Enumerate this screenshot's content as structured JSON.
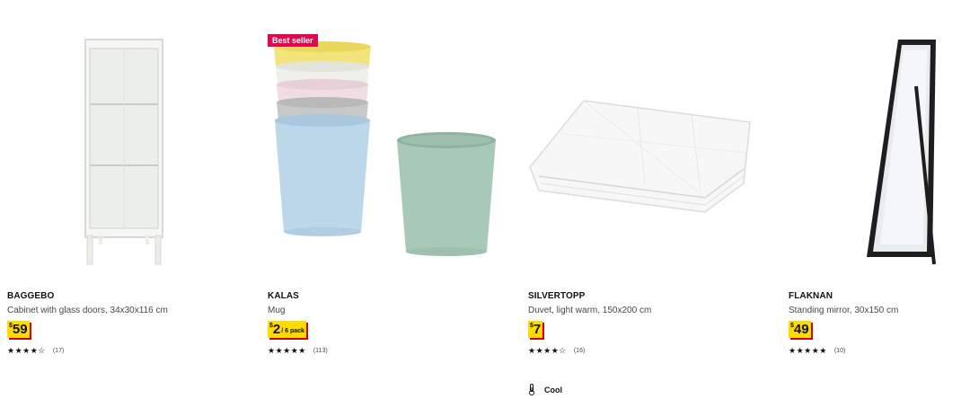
{
  "products": [
    {
      "name": "BAGGEBO",
      "description": "Cabinet with glass doors, 34x30x116 cm",
      "price_currency": "$",
      "price_amount": "59",
      "price_unit": "",
      "stars": "★★★★☆",
      "rating": 4.5,
      "review_count": "(17)",
      "image_icon": "glass-cabinet"
    },
    {
      "name": "KALAS",
      "description": "Mug",
      "badge": "Best seller",
      "price_currency": "$",
      "price_amount": "2",
      "price_unit": "/ 6 pack",
      "stars": "★★★★★",
      "rating": 5,
      "review_count": "(113)",
      "image_icon": "mugs"
    },
    {
      "name": "SILVERTOPP",
      "description": "Duvet, light warm, 150x200 cm",
      "price_currency": "$",
      "price_amount": "7",
      "price_unit": "",
      "stars": "★★★★☆",
      "rating": 4.5,
      "review_count": "(16)",
      "image_icon": "duvet",
      "extra_label": "Cool",
      "extra_icon": "thermometer-icon"
    },
    {
      "name": "FLAKNAN",
      "description": "Standing mirror, 30x150 cm",
      "price_currency": "$",
      "price_amount": "49",
      "price_unit": "",
      "stars": "★★★★★",
      "rating": 5,
      "review_count": "(10)",
      "image_icon": "standing-mirror"
    }
  ],
  "colors": {
    "price_bg": "#ffdb00",
    "price_shadow": "#cc0008",
    "badge_bg": "#e00751"
  }
}
